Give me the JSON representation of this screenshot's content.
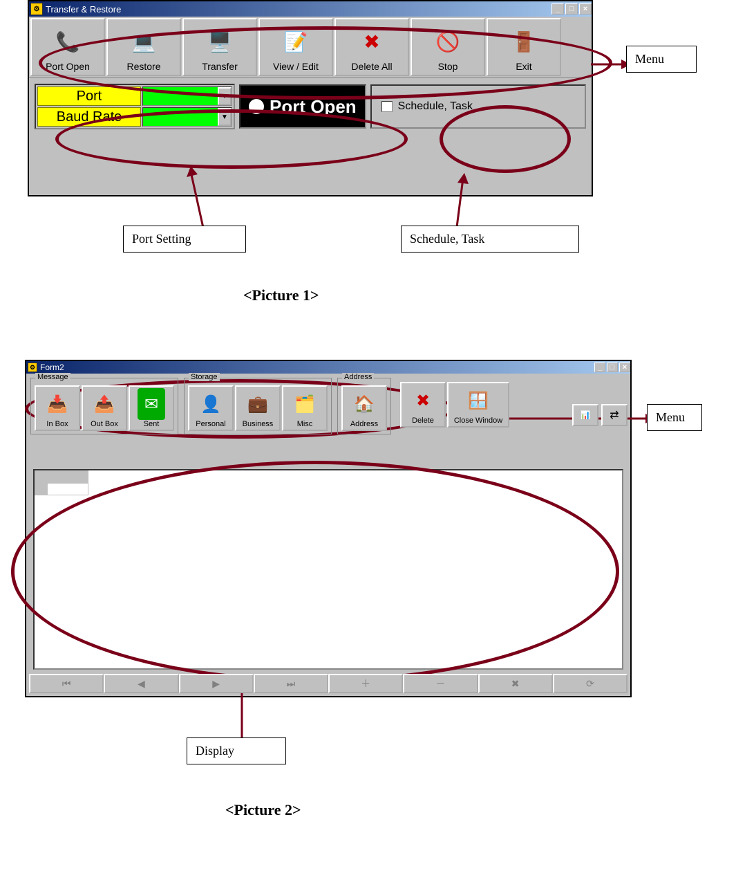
{
  "picture1": {
    "window_title": "Transfer & Restore",
    "toolbar": [
      {
        "label": "Port Open",
        "icon": "📞"
      },
      {
        "label": "Restore",
        "icon": "💻"
      },
      {
        "label": "Transfer",
        "icon": "🖥️"
      },
      {
        "label": "View / Edit",
        "icon": "📝"
      },
      {
        "label": "Delete All",
        "icon": "✖"
      },
      {
        "label": "Stop",
        "icon": "🚫"
      },
      {
        "label": "Exit",
        "icon": "🚪"
      }
    ],
    "port_label": "Port",
    "baud_label": "Baud Rate",
    "port_open_label": "Port Open",
    "schedule_label": "Schedule, Task"
  },
  "picture2": {
    "window_title": "Form2",
    "groups": {
      "message": {
        "label": "Message",
        "buttons": [
          {
            "label": "In Box",
            "icon": "📥"
          },
          {
            "label": "Out Box",
            "icon": "📤"
          },
          {
            "label": "Sent",
            "icon": "✉️"
          }
        ]
      },
      "storage": {
        "label": "Storage",
        "buttons": [
          {
            "label": "Personal",
            "icon": "👤"
          },
          {
            "label": "Business",
            "icon": "💼"
          },
          {
            "label": "Misc",
            "icon": "🗂️"
          }
        ]
      },
      "address": {
        "label": "Address",
        "buttons": [
          {
            "label": "Address",
            "icon": "🏠"
          }
        ]
      }
    },
    "right_buttons": [
      {
        "label": "Delete",
        "icon": "✖"
      },
      {
        "label": "Close Window",
        "icon": "🪟"
      }
    ],
    "nav_labels": [
      "First",
      "Prev",
      "Next",
      "Last",
      "Insert",
      "Delete",
      "Cancel",
      "Refresh"
    ],
    "nav_symbols": [
      "⏮",
      "◀",
      "▶",
      "⏭",
      "＋",
      "－",
      "✖",
      "⟳"
    ]
  },
  "callouts": {
    "menu": "Menu",
    "port_setting": "Port Setting",
    "schedule": "Schedule, Task",
    "display": "Display"
  },
  "captions": {
    "p1": "<Picture 1>",
    "p2": "<Picture 2>"
  }
}
